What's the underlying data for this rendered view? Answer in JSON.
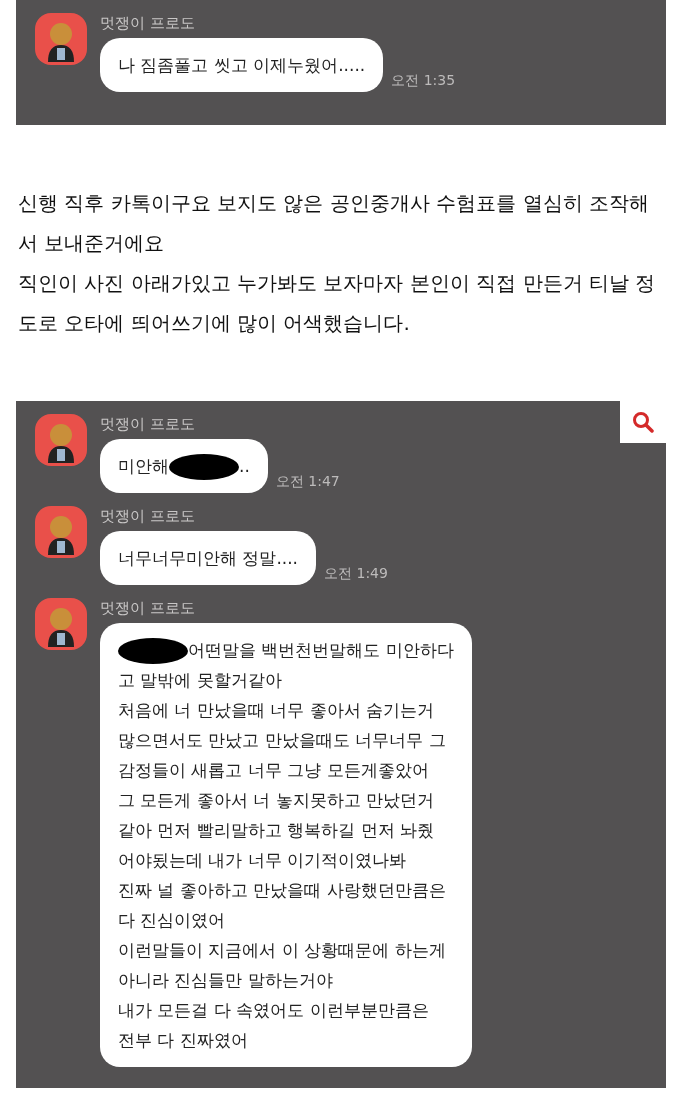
{
  "chat_top": {
    "messages": [
      {
        "sender": "멋쟁이 프로도",
        "time": "오전 1:35",
        "parts": [
          {
            "kind": "text",
            "text": "나 짐좀풀고 씻고 이제누웠어....."
          }
        ]
      }
    ]
  },
  "article": {
    "paragraphs": [
      "신행 직후 카톡이구요 보지도 않은 공인중개사 수험표를 열심히 조작해서 보내준거에요",
      "직인이 사진 아래가있고 누가봐도 보자마자 본인이 직접 만든거 티날 정도로 오타에 띄어쓰기에 많이 어색했습니다."
    ]
  },
  "chat_bottom": {
    "search_button": true,
    "messages": [
      {
        "sender": "멋쟁이 프로도",
        "time": "오전 1:47",
        "parts": [
          {
            "kind": "text",
            "text": "미안해"
          },
          {
            "kind": "redaction"
          },
          {
            "kind": "text",
            "text": ".."
          }
        ]
      },
      {
        "sender": "멋쟁이 프로도",
        "time": "오전 1:49",
        "parts": [
          {
            "kind": "text",
            "text": "너무너무미안해 정말...."
          }
        ]
      },
      {
        "sender": "멋쟁이 프로도",
        "parts": [
          {
            "kind": "redaction"
          },
          {
            "kind": "text",
            "text": "어떤말을 백번천번말해도 미안하다\n고 말밖에 못할거같아\n처음에 너 만났을때 너무 좋아서 숨기는거\n많으면서도 만났고 만났을때도 너무너무 그\n감정들이 새롭고 너무 그냥 모든게좋았어\n그 모든게 좋아서 너 놓지못하고 만났던거\n같아 먼저 빨리말하고 행복하길 먼저 놔줬\n어야됬는데 내가 너무 이기적이였나봐\n진짜 널 좋아하고 만났을때 사랑했던만큼은\n다 진심이였어\n이런말들이 지금에서 이 상황때문에 하는게\n아니라 진심들만 말하는거야\n내가 모든걸 다 속였어도 이런부분만큼은\n전부 다 진짜였어"
          }
        ]
      }
    ]
  }
}
